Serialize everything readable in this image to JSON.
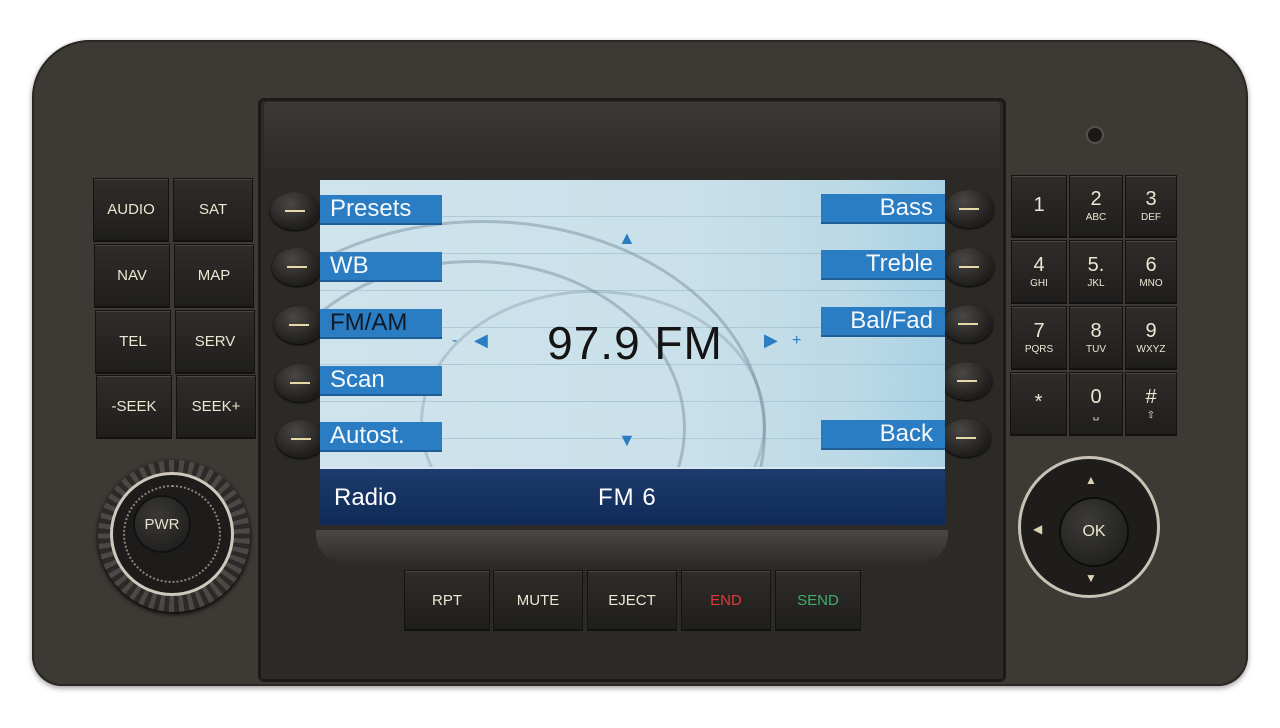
{
  "device": "car radio head unit",
  "left_buttons": [
    {
      "label": "AUDIO"
    },
    {
      "label": "SAT"
    },
    {
      "label": "NAV"
    },
    {
      "label": "MAP"
    },
    {
      "label": "TEL"
    },
    {
      "label": "SERV"
    },
    {
      "label": "-SEEK"
    },
    {
      "label": "SEEK+"
    }
  ],
  "power_knob": {
    "label": "PWR"
  },
  "screen": {
    "left_softkeys": [
      {
        "label": "Presets",
        "selected": false
      },
      {
        "label": "WB",
        "selected": false
      },
      {
        "label": "FM/AM",
        "selected": true
      },
      {
        "label": "Scan",
        "selected": false
      },
      {
        "label": "Autost.",
        "selected": false
      }
    ],
    "right_softkeys": [
      {
        "label": "Bass"
      },
      {
        "label": "Treble"
      },
      {
        "label": "Bal/Fad"
      },
      {
        "label": "Back"
      }
    ],
    "frequency": "97.9 FM",
    "minus_label": "-",
    "plus_label": "+",
    "arrow_up": "▲",
    "arrow_down": "▼",
    "arrow_left": "◀",
    "arrow_right": "▶",
    "status_left": "Radio",
    "status_center": "FM 6",
    "softkey_color": "#2a7cc3",
    "statusbar_color": "#1d3b6c"
  },
  "bottom_buttons": [
    {
      "label": "RPT",
      "color": "#ece6d2"
    },
    {
      "label": "MUTE",
      "color": "#ece6d2"
    },
    {
      "label": "EJECT",
      "color": "#ece6d2"
    },
    {
      "label": "END",
      "color": "#e03a3a"
    },
    {
      "label": "SEND",
      "color": "#3fae6a"
    }
  ],
  "keypad": [
    {
      "num": "1",
      "letters": ""
    },
    {
      "num": "2",
      "letters": "ABC"
    },
    {
      "num": "3",
      "letters": "DEF"
    },
    {
      "num": "4",
      "letters": "GHI"
    },
    {
      "num": "5.",
      "letters": "JKL"
    },
    {
      "num": "6",
      "letters": "MNO"
    },
    {
      "num": "7",
      "letters": "PQRS"
    },
    {
      "num": "8",
      "letters": "TUV"
    },
    {
      "num": "9",
      "letters": "WXYZ"
    },
    {
      "num": "*",
      "letters": ""
    },
    {
      "num": "0",
      "letters": "␣"
    },
    {
      "num": "#",
      "letters": "⇧"
    }
  ],
  "dpad": {
    "center_label": "OK",
    "up": "▲",
    "down": "▼",
    "left": "◀"
  }
}
